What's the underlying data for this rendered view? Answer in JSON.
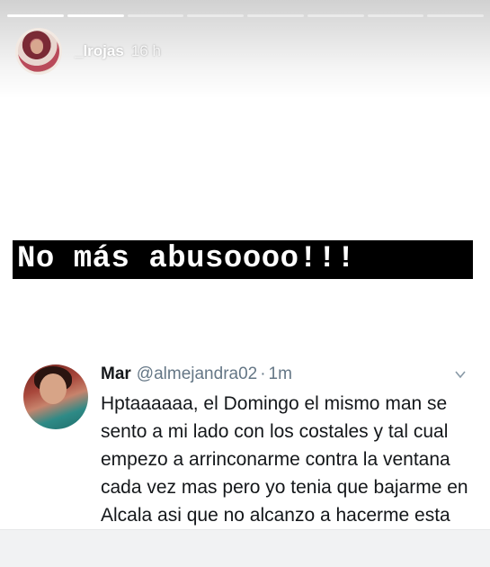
{
  "story": {
    "progress": {
      "segments": 8,
      "completed": 2
    },
    "user": {
      "username": "_lrojas",
      "time": "16 h"
    },
    "caption": "No más abusoooo!!!"
  },
  "tweet": {
    "display_name": "Mar",
    "handle": "@almejandra02",
    "separator": "·",
    "time": "1m",
    "text": "Hptaaaaaa, el Domingo el mismo man se sento a mi lado con los costales y tal cual empezo a arrinconarme contra la ventana cada vez mas pero yo tenia que bajarme en Alcala asi que no alcanzo a hacerme esta mierda, por fa difundan.",
    "menu_icon": "chevron-down-icon"
  }
}
